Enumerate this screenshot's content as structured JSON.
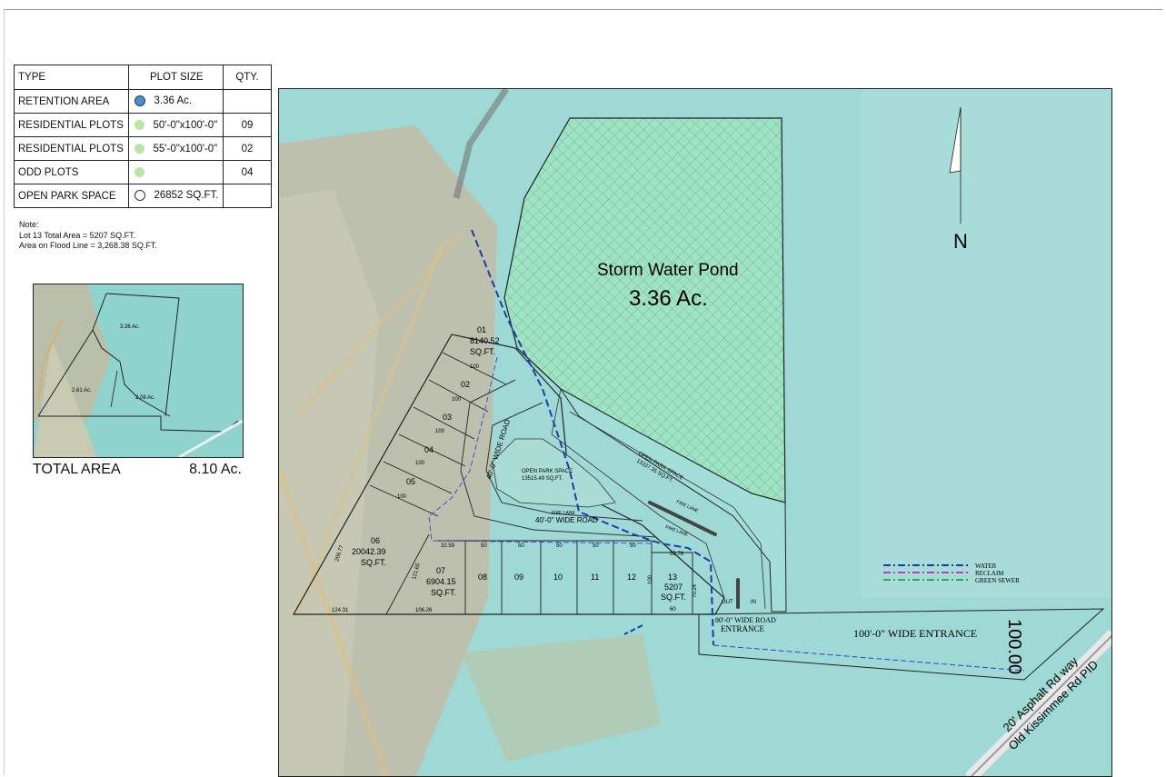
{
  "legend": {
    "headers": [
      "TYPE",
      "PLOT SIZE",
      "QTY."
    ],
    "rows": [
      {
        "type": "RETENTION AREA",
        "swatch": "blue",
        "size": "3.36 Ac.",
        "qty": ""
      },
      {
        "type": "RESIDENTIAL PLOTS",
        "swatch": "green",
        "size": "50'-0\"x100'-0\"",
        "qty": "09"
      },
      {
        "type": "RESIDENTIAL PLOTS",
        "swatch": "green",
        "size": "55'-0\"x100'-0\"",
        "qty": "02"
      },
      {
        "type": "ODD PLOTS",
        "swatch": "green",
        "size": "",
        "qty": "04"
      },
      {
        "type": "OPEN PARK SPACE",
        "swatch": "white",
        "size": "26852 SQ.FT.",
        "qty": ""
      }
    ]
  },
  "note": {
    "title": "Note:",
    "line1": "Lot 13 Total Area = 5207 SQ.FT.",
    "line2": "Area on Flood Line = 3,268.38 SQ.FT."
  },
  "minimap": {
    "a1": "3.36 Ac.",
    "a2": "2.61 Ac.",
    "a3": "2.08 Ac."
  },
  "total": {
    "label": "TOTAL AREA",
    "value": "8.10 Ac."
  },
  "map": {
    "pond_title": "Storm Water Pond",
    "pond_area": "3.36 Ac.",
    "north": "N",
    "lot01": [
      "01",
      "8140.52",
      "SQ.FT."
    ],
    "lot_nums": [
      "02",
      "03",
      "04",
      "05"
    ],
    "lot06": [
      "06",
      "20042.39",
      "SQ.FT."
    ],
    "lot07": [
      "07",
      "6904.15",
      "SQ.FT."
    ],
    "bottom_lots": [
      "08",
      "09",
      "10",
      "11",
      "12"
    ],
    "lot13": [
      "13",
      "5207",
      "SQ.FT."
    ],
    "dim_100": "100",
    "dim_50": "50",
    "dims": {
      "d1": "206.77",
      "d2": "124.31",
      "d3": "106.26",
      "d4": "121.65",
      "d5": "32.59",
      "d6": "60",
      "d7": "70.24",
      "d8": "55.78",
      "d9": "60"
    },
    "road_40_vert": "40'-0\" WIDE ROAD",
    "road_40_horz": "40'-0\" WIDE ROAD",
    "fire_lane": "FIRE LANE",
    "fire_lane2": "FIRE LANE",
    "fire_lane3": "FIRE LANE",
    "open_park_inner": [
      "OPEN PARK SPACE",
      "13515.49 SQ.FT."
    ],
    "open_park_strip": [
      "OPEN PARK SPACE",
      "13337.35 SQ.FT."
    ],
    "road_80": "80'-0\" WIDE ROAD",
    "entrance": "ENTRANCE",
    "out": "OUT",
    "in": "IN",
    "wide_entrance": "100'-0\" WIDE ENTRANCE",
    "entrance_width": "100.00",
    "asphalt1": "20' Asphalt Rd way",
    "asphalt2": "Old Kissimmee Rd PID",
    "utilities": [
      {
        "name": "WATER",
        "color": "#1a3fa8"
      },
      {
        "name": "RECLAIM",
        "color": "#b040c0"
      },
      {
        "name": "GREEN SEWER",
        "color": "#22b04a"
      }
    ]
  }
}
